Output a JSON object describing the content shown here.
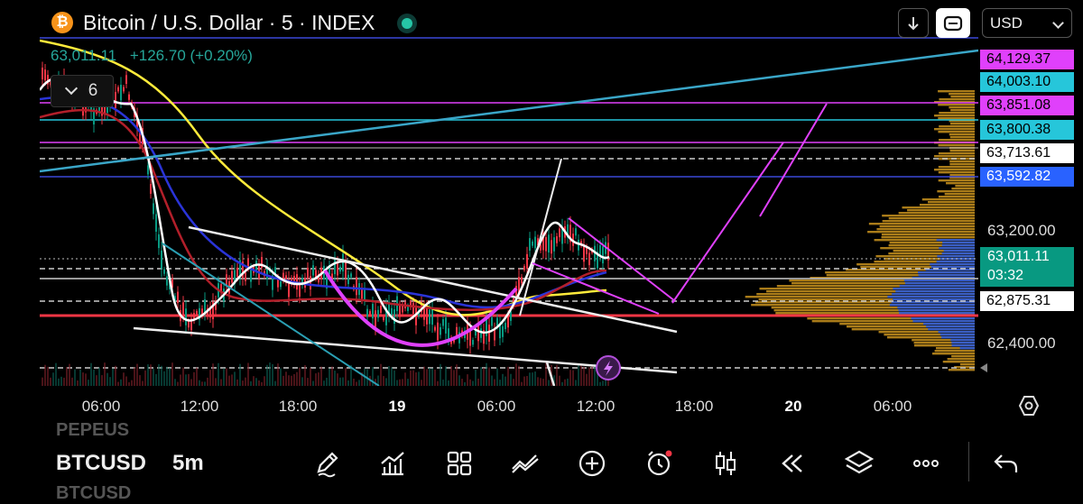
{
  "header": {
    "logo_glyph": "₿",
    "title": "Bitcoin / U.S. Dollar · 5 · INDEX",
    "currency": "USD",
    "ohlc_price": "63,011.11",
    "ohlc_change": "+126.70 (+0.20%)",
    "indicator_count": "6"
  },
  "price_labels": [
    {
      "text": "64,129.37",
      "bg": "#e040fb",
      "fg": "#000000",
      "price": 64129.37
    },
    {
      "text": "64,003.10",
      "bg": "#26c6da",
      "fg": "#000000",
      "price": 64003.1
    },
    {
      "text": "63,851.08",
      "bg": "#e040fb",
      "fg": "#000000",
      "price": 63851.08
    },
    {
      "text": "63,800.38",
      "bg": "#26c6da",
      "fg": "#000000",
      "price": 63800.38
    },
    {
      "text": "63,713.61",
      "bg": "#ffffff",
      "fg": "#000000",
      "price": 63713.61
    },
    {
      "text": "63,592.82",
      "bg": "#2962ff",
      "fg": "#ffffff",
      "price": 63592.82
    },
    {
      "text": "62,875.31",
      "bg": "#ffffff",
      "fg": "#000000",
      "price": 62875.31
    }
  ],
  "current_price": {
    "price": "63,011.11",
    "countdown": "03:32"
  },
  "price_axis": [
    "63,200.00",
    "62,400.00"
  ],
  "time_axis": [
    {
      "label": "06:00",
      "bold": false
    },
    {
      "label": "12:00",
      "bold": false
    },
    {
      "label": "18:00",
      "bold": false
    },
    {
      "label": "19",
      "bold": true
    },
    {
      "label": "06:00",
      "bold": false
    },
    {
      "label": "12:00",
      "bold": false
    },
    {
      "label": "18:00",
      "bold": false
    },
    {
      "label": "20",
      "bold": true
    },
    {
      "label": "06:00",
      "bold": false
    }
  ],
  "toolbar": {
    "ghost_top": "PEPEUS",
    "symbol": "BTCUSD",
    "interval": "5m",
    "ghost_bottom": "BTCUSD",
    "tools": [
      "pencil-icon",
      "indicators-icon",
      "templates-icon",
      "compare-icon",
      "plus-icon",
      "alert-icon",
      "candle-style-icon",
      "replay-icon",
      "layers-icon",
      "more-icon"
    ]
  },
  "colors": {
    "up": "#089981",
    "down": "#f23645",
    "accent": "#e040fb",
    "bg": "#000000"
  }
}
